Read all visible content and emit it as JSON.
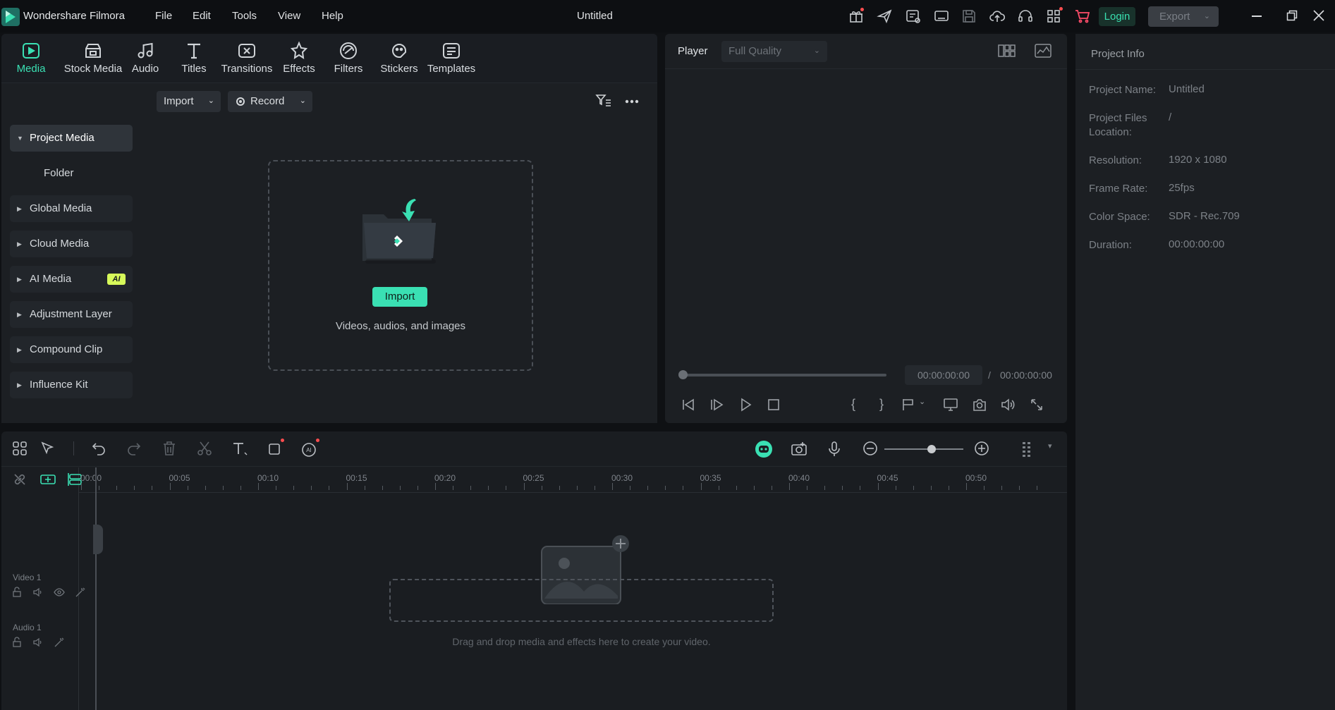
{
  "app": {
    "name": "Wondershare Filmora",
    "window_title": "Untitled"
  },
  "menu": [
    "File",
    "Edit",
    "Tools",
    "View",
    "Help"
  ],
  "titlebar": {
    "login_label": "Login",
    "export_label": "Export",
    "icons": [
      "gift-icon",
      "send-icon",
      "feedback-icon",
      "screen-icon",
      "save-icon",
      "cloud-upload-icon",
      "headset-icon",
      "apps-icon",
      "cart-icon"
    ]
  },
  "tabs": [
    {
      "label": "Media",
      "icon": "media-icon",
      "active": true
    },
    {
      "label": "Stock Media",
      "icon": "stock-media-icon"
    },
    {
      "label": "Audio",
      "icon": "audio-icon"
    },
    {
      "label": "Titles",
      "icon": "titles-icon"
    },
    {
      "label": "Transitions",
      "icon": "transitions-icon"
    },
    {
      "label": "Effects",
      "icon": "effects-icon"
    },
    {
      "label": "Filters",
      "icon": "filters-icon"
    },
    {
      "label": "Stickers",
      "icon": "stickers-icon"
    },
    {
      "label": "Templates",
      "icon": "templates-icon"
    }
  ],
  "sidebar": {
    "items": [
      {
        "label": "Project Media",
        "active": true
      },
      {
        "label": "Folder"
      },
      {
        "label": "Global Media"
      },
      {
        "label": "Cloud Media"
      },
      {
        "label": "AI Media",
        "badge": "AI"
      },
      {
        "label": "Adjustment Layer"
      },
      {
        "label": "Compound Clip"
      },
      {
        "label": "Influence Kit"
      }
    ]
  },
  "media": {
    "import_dropdown": "Import",
    "record_dropdown": "Record",
    "import_button": "Import",
    "dropzone_caption": "Videos, audios, and images"
  },
  "player": {
    "label": "Player",
    "quality": "Full Quality",
    "current_time": "00:00:00:00",
    "separator": "/",
    "total_time": "00:00:00:00"
  },
  "info": {
    "title": "Project Info",
    "rows": [
      {
        "label": "Project Name:",
        "value": "Untitled"
      },
      {
        "label": "Project Files Location:",
        "value": "/"
      },
      {
        "label": "Resolution:",
        "value": "1920 x 1080"
      },
      {
        "label": "Frame Rate:",
        "value": "25fps"
      },
      {
        "label": "Color Space:",
        "value": "SDR - Rec.709"
      },
      {
        "label": "Duration:",
        "value": "00:00:00:00"
      }
    ]
  },
  "timeline": {
    "ruler": [
      "00:00",
      "00:05",
      "00:10",
      "00:15",
      "00:20",
      "00:25",
      "00:30",
      "00:35",
      "00:40",
      "00:45",
      "00:50"
    ],
    "tracks": [
      {
        "label": "Video 1"
      },
      {
        "label": "Audio 1"
      }
    ],
    "drop_caption": "Drag and drop media and effects here to create your video."
  },
  "colors": {
    "accent": "#3ae0b3",
    "panel": "#1c1f23",
    "background": "#0f1114",
    "ai_badge": "#d7f95a",
    "notify": "#ff4d4f"
  }
}
